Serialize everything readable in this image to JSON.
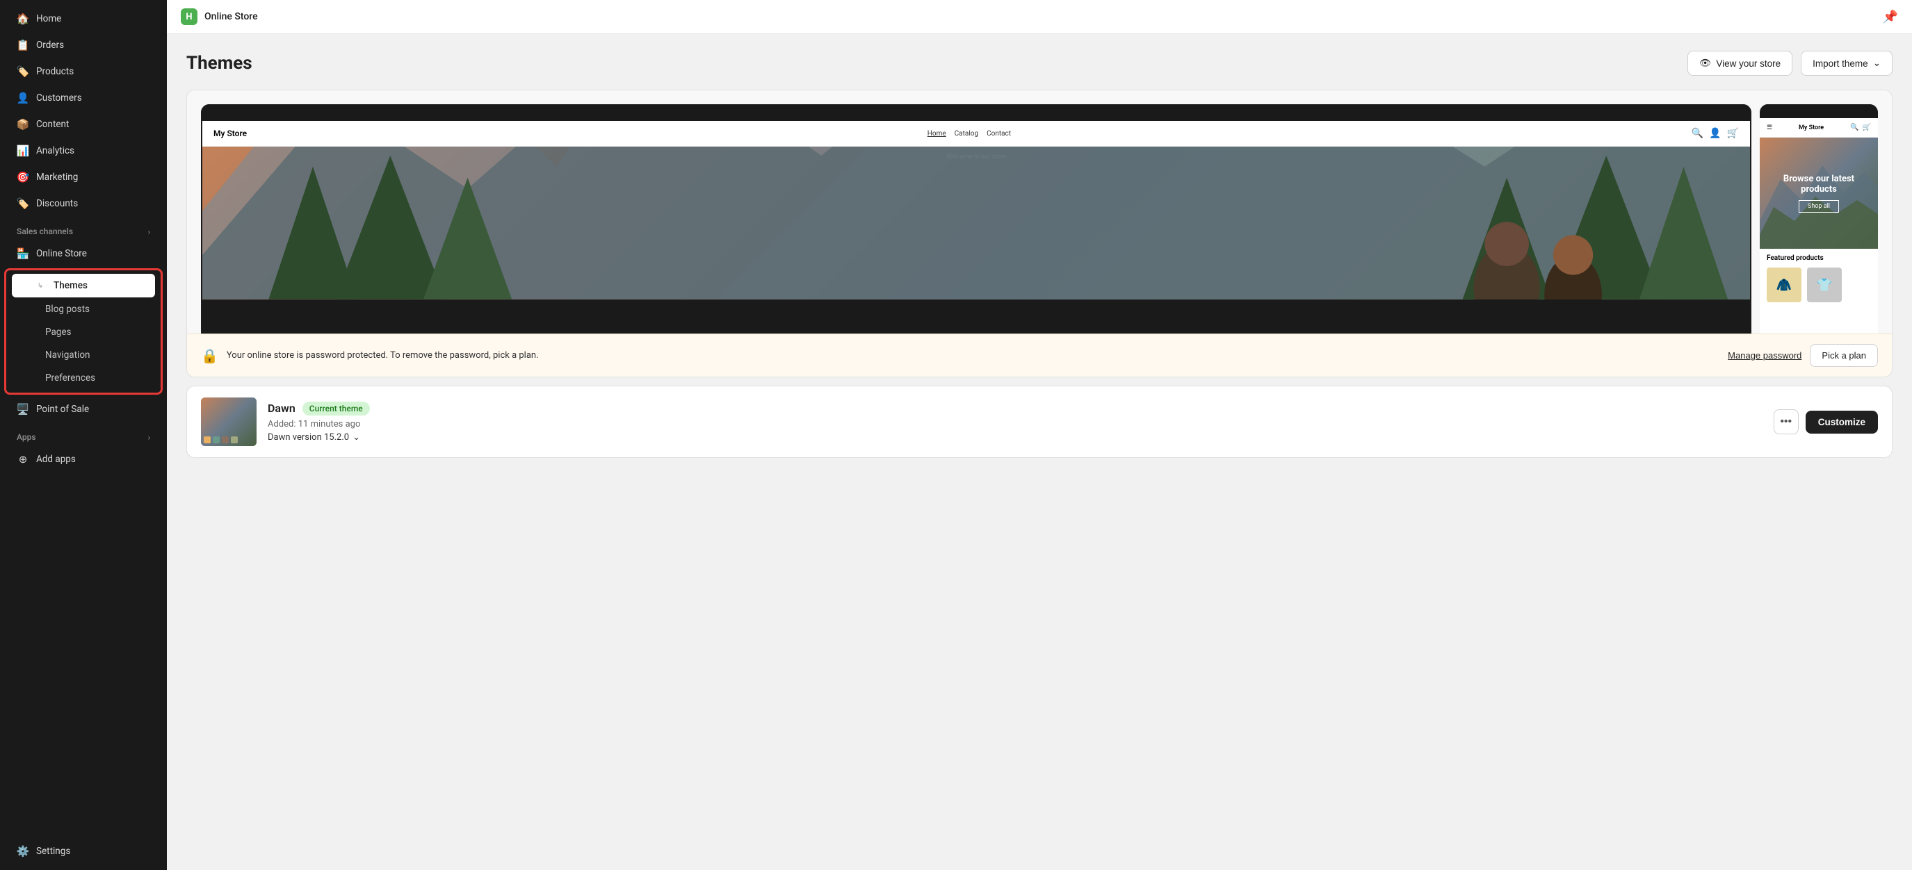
{
  "topbar": {
    "store_icon": "H",
    "store_name": "Online Store",
    "pin_icon": "📌"
  },
  "sidebar": {
    "nav_items": [
      {
        "id": "home",
        "label": "Home",
        "icon": "🏠"
      },
      {
        "id": "orders",
        "label": "Orders",
        "icon": "📋"
      },
      {
        "id": "products",
        "label": "Products",
        "icon": "🏷️"
      },
      {
        "id": "customers",
        "label": "Customers",
        "icon": "👤"
      },
      {
        "id": "content",
        "label": "Content",
        "icon": "📦"
      },
      {
        "id": "analytics",
        "label": "Analytics",
        "icon": "📊"
      },
      {
        "id": "marketing",
        "label": "Marketing",
        "icon": "🎯"
      },
      {
        "id": "discounts",
        "label": "Discounts",
        "icon": "🏷️"
      }
    ],
    "sales_channels_label": "Sales channels",
    "sales_channels_chevron": "›",
    "online_store_label": "Online Store",
    "sub_items": [
      {
        "id": "themes",
        "label": "Themes",
        "active": true
      },
      {
        "id": "blog-posts",
        "label": "Blog posts"
      },
      {
        "id": "pages",
        "label": "Pages"
      },
      {
        "id": "navigation",
        "label": "Navigation"
      },
      {
        "id": "preferences",
        "label": "Preferences"
      }
    ],
    "point_of_sale_label": "Point of Sale",
    "apps_label": "Apps",
    "apps_chevron": "›",
    "add_apps_label": "Add apps",
    "settings_label": "Settings"
  },
  "page": {
    "title": "Themes",
    "view_store_label": "View your store",
    "import_theme_label": "Import theme"
  },
  "store_preview": {
    "store_name": "My Store",
    "nav_home": "Home",
    "nav_catalog": "Catalog",
    "nav_contact": "Contact",
    "hero_text": "Welcome to our store",
    "mobile_hero_title": "Browse our latest products",
    "mobile_hero_btn": "Shop all",
    "mobile_featured_label": "Featured products"
  },
  "password_banner": {
    "icon": "🔒",
    "text": "Your online store is password protected. To remove the password, pick a plan.",
    "manage_pwd_label": "Manage password",
    "pick_plan_label": "Pick a plan"
  },
  "theme": {
    "name": "Dawn",
    "badge_label": "Current theme",
    "added_label": "Added: 11 minutes ago",
    "version_label": "Dawn version 15.2.0",
    "version_chevron": "⌄",
    "more_icon": "•••",
    "customize_label": "Customize"
  },
  "arrow": {
    "visible": true
  }
}
